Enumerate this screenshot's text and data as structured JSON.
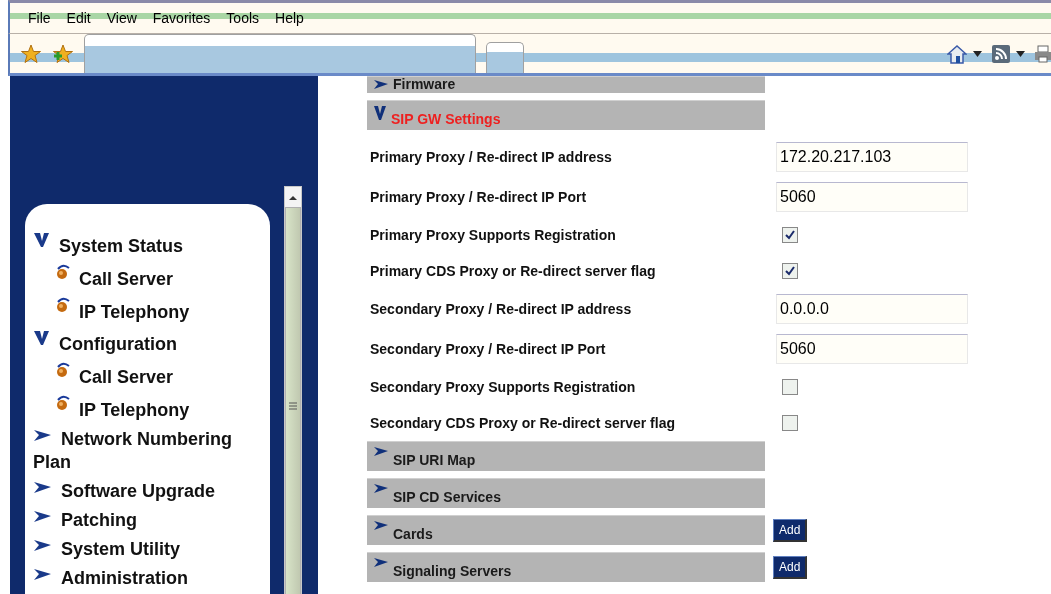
{
  "menu": [
    {
      "label": "File"
    },
    {
      "label": "Edit"
    },
    {
      "label": "View"
    },
    {
      "label": "Favorites"
    },
    {
      "label": "Tools"
    },
    {
      "label": "Help"
    }
  ],
  "nav": [
    {
      "label": "System Status",
      "expanded": true,
      "children": [
        {
          "label": "Call Server"
        },
        {
          "label": "IP Telephony"
        }
      ]
    },
    {
      "label": "Configuration",
      "expanded": true,
      "children": [
        {
          "label": "Call Server"
        },
        {
          "label": "IP Telephony"
        }
      ]
    },
    {
      "label": "Network Numbering Plan",
      "expanded": false
    },
    {
      "label": "Software Upgrade",
      "expanded": false
    },
    {
      "label": "Patching",
      "expanded": false
    },
    {
      "label": "System Utility",
      "expanded": false
    },
    {
      "label": "Administration",
      "expanded": false
    }
  ],
  "content": [
    {
      "kind": "section",
      "label": "Firmware",
      "expanded": false,
      "selected": false
    },
    {
      "kind": "section",
      "label": "SIP GW Settings",
      "expanded": true,
      "selected": true
    },
    {
      "kind": "text",
      "label": "Primary Proxy / Re-direct IP address",
      "value": "172.20.217.103"
    },
    {
      "kind": "text",
      "label": "Primary Proxy / Re-direct IP Port",
      "value": "5060"
    },
    {
      "kind": "checkbox",
      "label": "Primary Proxy Supports Registration",
      "checked": true
    },
    {
      "kind": "checkbox",
      "label": "Primary CDS Proxy or Re-direct server flag",
      "checked": true
    },
    {
      "kind": "text",
      "label": "Secondary Proxy / Re-direct IP address",
      "value": "0.0.0.0"
    },
    {
      "kind": "text",
      "label": "Secondary Proxy / Re-direct IP Port",
      "value": "5060"
    },
    {
      "kind": "checkbox",
      "label": "Secondary Proxy Supports Registration",
      "checked": false
    },
    {
      "kind": "checkbox",
      "label": "Secondary CDS Proxy or Re-direct server flag",
      "checked": false
    },
    {
      "kind": "section",
      "label": "SIP URI Map",
      "expanded": false,
      "selected": false
    },
    {
      "kind": "section",
      "label": "SIP CD Services",
      "expanded": false,
      "selected": false
    },
    {
      "kind": "section",
      "label": "Cards",
      "expanded": false,
      "selected": false,
      "action": "Add"
    },
    {
      "kind": "section",
      "label": "Signaling Servers",
      "expanded": false,
      "selected": false,
      "action": "Add"
    }
  ]
}
